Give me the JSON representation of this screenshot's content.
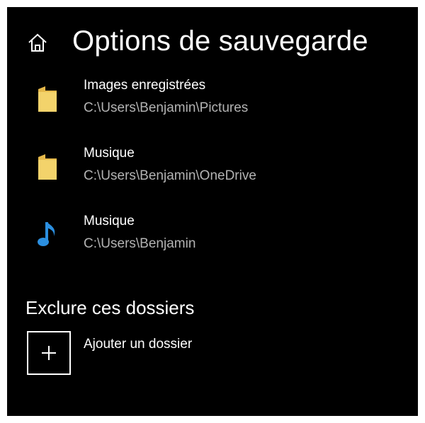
{
  "header": {
    "title": "Options de sauvegarde",
    "home_icon": "home-icon"
  },
  "folders": [
    {
      "name": "Images enregistrées",
      "path": "C:\\Users\\Benjamin\\Pictures",
      "icon": "folder-icon"
    },
    {
      "name": "Musique",
      "path": "C:\\Users\\Benjamin\\OneDrive",
      "icon": "folder-icon"
    },
    {
      "name": "Musique",
      "path": "C:\\Users\\Benjamin",
      "icon": "music-note-icon"
    }
  ],
  "exclude": {
    "title": "Exclure ces dossiers",
    "add_label": "Ajouter un dossier",
    "add_icon": "plus-icon"
  },
  "colors": {
    "background": "#000000",
    "text": "#ffffff",
    "secondary_text": "#b3b3b3",
    "folder": "#f3d36b",
    "music_accent": "#2b8fe0"
  }
}
